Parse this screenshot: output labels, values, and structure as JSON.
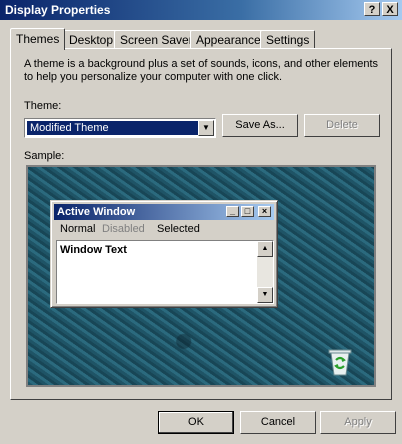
{
  "window": {
    "title": "Display Properties",
    "help_label": "?",
    "close_label": "X"
  },
  "tabs": [
    {
      "label": "Themes",
      "active": true
    },
    {
      "label": "Desktop"
    },
    {
      "label": "Screen Saver"
    },
    {
      "label": "Appearance"
    },
    {
      "label": "Settings"
    }
  ],
  "themes": {
    "description": "A theme is a background plus a set of sounds, icons, and other elements to help you personalize your computer with one click.",
    "theme_label": "Theme:",
    "theme_value": "Modified Theme",
    "save_as_label": "Save As...",
    "delete_label": "Delete",
    "sample_label": "Sample:"
  },
  "preview": {
    "title": "Active Window",
    "menu_normal": "Normal",
    "menu_disabled": "Disabled",
    "menu_selected": "Selected",
    "window_text": "Window Text"
  },
  "footer": {
    "ok_label": "OK",
    "cancel_label": "Cancel",
    "apply_label": "Apply"
  },
  "colors": {
    "titlebar": "#0a246a",
    "face": "#d4d0c8",
    "desktop": "#235d70"
  }
}
